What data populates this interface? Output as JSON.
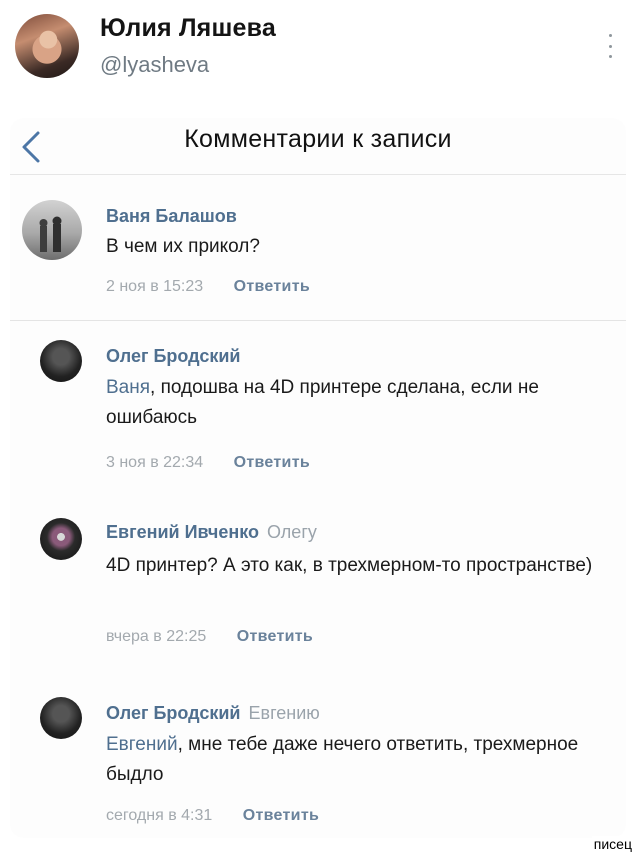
{
  "tweet": {
    "author_name": "Юлия Ляшева",
    "author_handle": "@lyasheva"
  },
  "screenshot": {
    "title": "Комментарии к записи",
    "comments": [
      {
        "author": "Ваня Балашов",
        "reply_to": "",
        "mention": "",
        "text": "В чем их прикол?",
        "time": "2 ноя в 15:23",
        "action": "Ответить"
      },
      {
        "author": "Олег Бродский",
        "reply_to": "",
        "mention": "Ваня",
        "text": ", подошва на 4D принтере сделана, если не ошибаюсь",
        "time": "3 ноя в 22:34",
        "action": "Ответить"
      },
      {
        "author": "Евгений Ивченко",
        "reply_to": "Олегу",
        "mention": "",
        "text": "4D принтер? А это как, в трехмерном-то пространстве)",
        "time": "вчера в 22:25",
        "action": "Ответить"
      },
      {
        "author": "Олег Бродский",
        "reply_to": "Евгению",
        "mention": "Евгений",
        "text": ", мне тебе даже нечего ответить, трехмерное быдло",
        "time": "сегодня в 4:31",
        "action": "Ответить"
      }
    ]
  },
  "watermark": "писец"
}
